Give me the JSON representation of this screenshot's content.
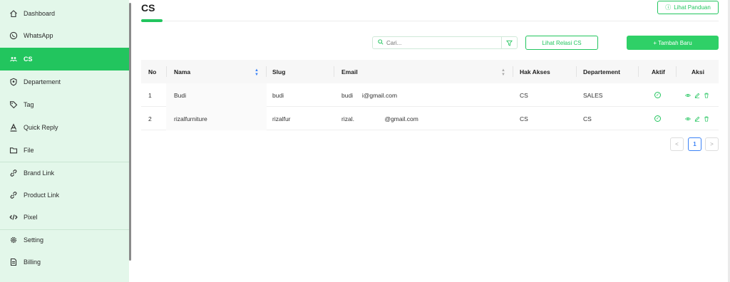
{
  "sidebar": {
    "items": [
      {
        "label": "Dashboard",
        "icon": "home-icon"
      },
      {
        "label": "WhatsApp",
        "icon": "whatsapp-icon"
      },
      {
        "label": "CS",
        "icon": "users-icon",
        "active": true
      },
      {
        "label": "Departement",
        "icon": "badge-icon"
      },
      {
        "label": "Tag",
        "icon": "tag-icon"
      },
      {
        "label": "Quick Reply",
        "icon": "text-a-icon"
      },
      {
        "label": "File",
        "icon": "folder-icon"
      },
      {
        "label": "Brand Link",
        "icon": "link-icon"
      },
      {
        "label": "Product Link",
        "icon": "link-icon"
      },
      {
        "label": "Pixel",
        "icon": "code-icon"
      },
      {
        "label": "Setting",
        "icon": "gear-icon"
      },
      {
        "label": "Billing",
        "icon": "receipt-icon"
      }
    ]
  },
  "header": {
    "title": "CS",
    "guide_button": "Lihat Panduan"
  },
  "toolbar": {
    "search_placeholder": "Cari...",
    "relasi_button": "Lihat Relasi CS",
    "add_button": "+ Tambah Baru"
  },
  "table": {
    "columns": [
      "No",
      "Nama",
      "Slug",
      "Email",
      "Hak Akses",
      "Departement",
      "Aktif",
      "Aksi"
    ],
    "rows": [
      {
        "no": "1",
        "nama": "Budi",
        "slug": "budi",
        "email_pre": "budi",
        "email_post": "i@gmail.com",
        "hak_akses": "CS",
        "departement": "SALES"
      },
      {
        "no": "2",
        "nama": "rizalfurniture",
        "slug": "rizalfur",
        "email_pre": "rizal.",
        "email_post": "@gmail.com",
        "hak_akses": "CS",
        "departement": "CS"
      }
    ]
  },
  "pagination": {
    "prev": "<",
    "current": "1",
    "next": ">"
  },
  "colors": {
    "accent": "#22c55e",
    "sidebar_bg": "#e3f7ea",
    "link_blue": "#3b82f6"
  }
}
